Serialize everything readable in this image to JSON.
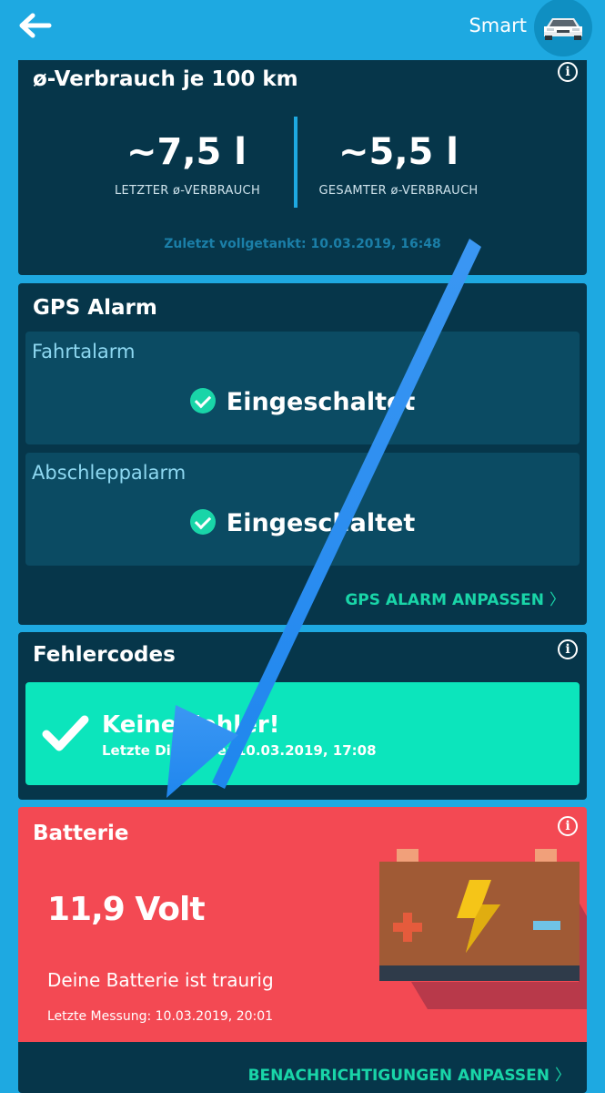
{
  "header": {
    "car_name": "Smart",
    "back_icon": "arrow-left-icon",
    "avatar_icon": "car-icon"
  },
  "consumption": {
    "title": "ø-Verbrauch je 100 km",
    "last_value": "~7,5 l",
    "last_label": "LETZTER ø-VERBRAUCH",
    "total_value": "~5,5 l",
    "total_label": "GESAMTER ø-VERBRAUCH",
    "last_refuel": "Zuletzt vollgetankt: 10.03.2019, 16:48"
  },
  "gps_alarm": {
    "title": "GPS Alarm",
    "drive_alarm": {
      "title": "Fahrtalarm",
      "status": "Eingeschaltet"
    },
    "tow_alarm": {
      "title": "Abschleppalarm",
      "status": "Eingeschaltet"
    },
    "action": "GPS ALARM ANPASSEN"
  },
  "faults": {
    "title": "Fehlercodes",
    "status": "Keine Fehler!",
    "last_diagnosis": "Letzte Diagnose: 10.03.2019, 17:08"
  },
  "battery": {
    "title": "Batterie",
    "voltage": "11,9 Volt",
    "message": "Deine Batterie ist traurig",
    "last_measure": "Letzte Messung: 10.03.2019, 20:01",
    "action": "BENACHRICHTIGUNGEN ANPASSEN"
  },
  "colors": {
    "background": "#1ea9e1",
    "card": "#06364a",
    "accent": "#19d5a8",
    "battery_alert": "#f34953",
    "overlay_arrow": "#2a8df0"
  },
  "info_glyph": "i"
}
